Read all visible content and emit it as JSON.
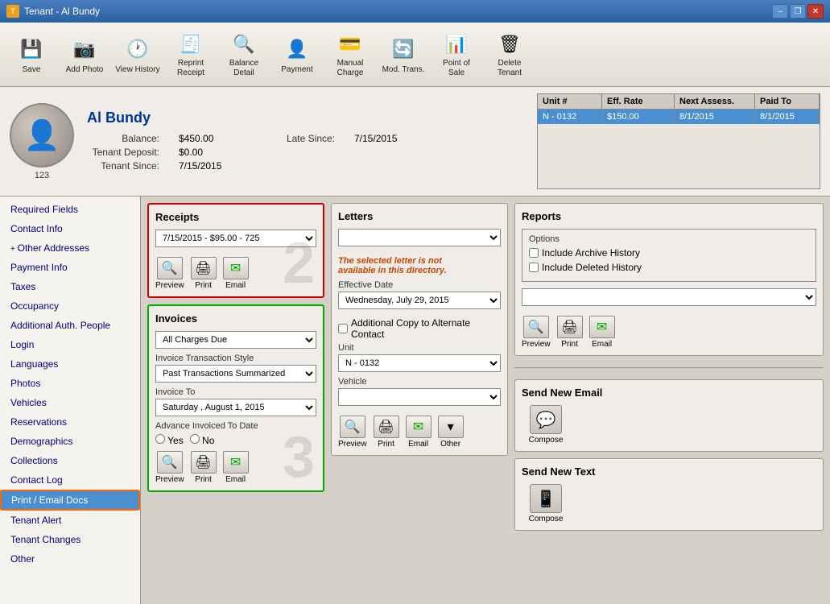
{
  "window": {
    "title": "Tenant - Al Bundy",
    "icon_label": "T"
  },
  "titlebar": {
    "minimize": "–",
    "restore": "❐",
    "close": "✕"
  },
  "toolbar": {
    "buttons": [
      {
        "id": "save",
        "label": "Save",
        "icon": "💾"
      },
      {
        "id": "add-photo",
        "label": "Add Photo",
        "icon": "📷"
      },
      {
        "id": "view-history",
        "label": "View History",
        "icon": "🕐"
      },
      {
        "id": "reprint-receipt",
        "label": "Reprint Receipt",
        "icon": "🧾"
      },
      {
        "id": "balance-detail",
        "label": "Balance Detail",
        "icon": "⚖"
      },
      {
        "id": "payment",
        "label": "Payment",
        "icon": "👤"
      },
      {
        "id": "manual-charge",
        "label": "Manual Charge",
        "icon": "💳"
      },
      {
        "id": "mod-trans",
        "label": "Mod. Trans.",
        "icon": "🔄"
      },
      {
        "id": "point-of-sale",
        "label": "Point of Sale",
        "icon": "📊"
      },
      {
        "id": "delete-tenant",
        "label": "Delete Tenant",
        "icon": "🗑"
      }
    ]
  },
  "tenant": {
    "name": "Al Bundy",
    "id": "123",
    "balance_label": "Balance:",
    "balance_value": "$450.00",
    "late_since_label": "Late Since:",
    "late_since_value": "7/15/2015",
    "deposit_label": "Tenant Deposit:",
    "deposit_value": "$0.00",
    "since_label": "Tenant Since:",
    "since_value": "7/15/2015"
  },
  "unit_table": {
    "headers": [
      "Unit #",
      "Eff. Rate",
      "Next Assess.",
      "Paid To"
    ],
    "rows": [
      {
        "unit": "N - 0132",
        "eff_rate": "$150.00",
        "next_assess": "8/1/2015",
        "paid_to": "8/1/2015"
      }
    ]
  },
  "sidebar": {
    "items": [
      {
        "id": "required-fields",
        "label": "Required Fields",
        "active": false
      },
      {
        "id": "contact-info",
        "label": "Contact Info",
        "active": false
      },
      {
        "id": "other-addresses",
        "label": "Other Addresses",
        "active": false,
        "has_plus": true
      },
      {
        "id": "payment-info",
        "label": "Payment Info",
        "active": false
      },
      {
        "id": "taxes",
        "label": "Taxes",
        "active": false
      },
      {
        "id": "occupancy",
        "label": "Occupancy",
        "active": false
      },
      {
        "id": "additional-auth",
        "label": "Additional Auth. People",
        "active": false
      },
      {
        "id": "login",
        "label": "Login",
        "active": false
      },
      {
        "id": "languages",
        "label": "Languages",
        "active": false
      },
      {
        "id": "photos",
        "label": "Photos",
        "active": false
      },
      {
        "id": "vehicles",
        "label": "Vehicles",
        "active": false
      },
      {
        "id": "reservations",
        "label": "Reservations",
        "active": false
      },
      {
        "id": "demographics",
        "label": "Demographics",
        "active": false
      },
      {
        "id": "collections",
        "label": "Collections",
        "active": false
      },
      {
        "id": "contact-log",
        "label": "Contact Log",
        "active": false
      },
      {
        "id": "print-email-docs",
        "label": "Print / Email Docs",
        "active": true
      },
      {
        "id": "tenant-alert",
        "label": "Tenant Alert",
        "active": false
      },
      {
        "id": "tenant-changes",
        "label": "Tenant Changes",
        "active": false
      },
      {
        "id": "other",
        "label": "Other",
        "active": false
      }
    ]
  },
  "receipts": {
    "title": "Receipts",
    "dropdown_value": "7/15/2015 - $95.00 - 725",
    "badge": "2",
    "buttons": {
      "preview": "Preview",
      "print": "Print",
      "email": "Email"
    }
  },
  "invoices": {
    "title": "Invoices",
    "charges_label": "All Charges Due",
    "style_label": "Invoice Transaction Style",
    "style_value": "Past Transactions Summarized",
    "invoice_to_label": "Invoice To",
    "invoice_to_value": "Saturday ,  August  1, 2015",
    "advance_label": "Advance Invoiced To Date",
    "yes_label": "Yes",
    "no_label": "No",
    "badge": "3",
    "buttons": {
      "preview": "Preview",
      "print": "Print",
      "email": "Email"
    }
  },
  "letters": {
    "title": "Letters",
    "warning": "The selected letter is not\navailable in this directory.",
    "effective_date_label": "Effective Date",
    "effective_date_value": "Wednesday,  July  29, 2015",
    "alt_copy_label": "Additional Copy to Alternate Contact",
    "unit_label": "Unit",
    "unit_value": "N - 0132",
    "vehicle_label": "Vehicle",
    "buttons": {
      "preview": "Preview",
      "print": "Print",
      "email": "Email",
      "other": "Other"
    }
  },
  "reports": {
    "title": "Reports",
    "options_label": "Options",
    "include_archive": "Include Archive History",
    "include_deleted": "Include Deleted History",
    "buttons": {
      "preview": "Preview",
      "print": "Print",
      "email": "Email"
    }
  },
  "send_email": {
    "title": "Send New Email",
    "compose_label": "Compose"
  },
  "send_text": {
    "title": "Send New Text",
    "compose_label": "Compose"
  }
}
